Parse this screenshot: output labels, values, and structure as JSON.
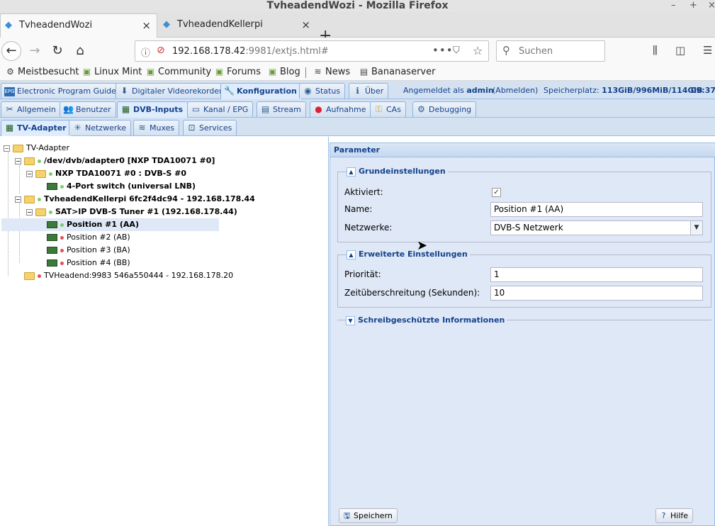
{
  "window": {
    "title": "TvheadendWozi - Mozilla Firefox",
    "min": "–",
    "max": "+",
    "close": "×"
  },
  "browser_tabs": [
    {
      "label": "TvheadendWozi",
      "active": true
    },
    {
      "label": "TvheadendKellerpi",
      "active": false
    }
  ],
  "tab_close": "×",
  "new_tab": "+",
  "nav": {
    "back": "←",
    "forward": "→",
    "reload": "↻",
    "home": "⌂",
    "url_host": "192.168.178.42",
    "url_rest": ":9981/extjs.html#",
    "url_dots": "•••",
    "search_placeholder": "Suchen",
    "library": "⫼",
    "sidebar": "◫",
    "menu": "☰"
  },
  "bookmarks": [
    {
      "label": "Meistbesucht",
      "icon": "gear-icon"
    },
    {
      "label": "Linux Mint",
      "icon": "mint-icon"
    },
    {
      "label": "Community",
      "icon": "mint-icon"
    },
    {
      "label": "Forums",
      "icon": "mint-icon"
    },
    {
      "label": "Blog",
      "icon": "mint-icon"
    },
    {
      "label": "News",
      "icon": "rss-icon"
    },
    {
      "label": "Bananaserver",
      "icon": "page-icon"
    }
  ],
  "main_tabs": [
    {
      "label": "Electronic Program Guide",
      "icon": "EPG"
    },
    {
      "label": "Digitaler Videorekorder",
      "icon": "⬇"
    },
    {
      "label": "Konfiguration",
      "icon": "🔧",
      "active": true
    },
    {
      "label": "Status",
      "icon": "👁"
    },
    {
      "label": "Über",
      "icon": "ℹ"
    }
  ],
  "status": {
    "logged_in_prefix": "Angemeldet als",
    "user": "admin",
    "logout": "(Abmelden)",
    "storage_prefix": "Speicherplatz:",
    "storage": "113GiB/996MiB/114GiB",
    "time": "09:37:3"
  },
  "config_tabs": [
    {
      "label": "Allgemein",
      "icon": "✂"
    },
    {
      "label": "Benutzer",
      "icon": "👥"
    },
    {
      "label": "DVB-Inputs",
      "icon": "▦",
      "active": true
    },
    {
      "label": "Kanal / EPG",
      "icon": "📺"
    },
    {
      "label": "Stream",
      "icon": "▤"
    },
    {
      "label": "Aufnahme",
      "icon": "●"
    },
    {
      "label": "CAs",
      "icon": "🔑"
    },
    {
      "label": "Debugging",
      "icon": "⚙"
    }
  ],
  "dvb_tabs": [
    {
      "label": "TV-Adapter",
      "icon": "▦",
      "active": true
    },
    {
      "label": "Netzwerke",
      "icon": "✳"
    },
    {
      "label": "Muxes",
      "icon": "≋"
    },
    {
      "label": "Services",
      "icon": "⊡"
    }
  ],
  "tree": [
    {
      "label": "TV-Adapter",
      "bold": false
    },
    {
      "label": "/dev/dvb/adapter0 [NXP TDA10071 #0]",
      "bold": true
    },
    {
      "label": "NXP TDA10071 #0 : DVB-S #0",
      "bold": true
    },
    {
      "label": "4-Port switch (universal LNB)",
      "bold": true
    },
    {
      "label": "TvheadendKellerpi 6fc2f4dc94 - 192.168.178.44",
      "bold": true
    },
    {
      "label": "SAT>IP DVB-S Tuner #1 (192.168.178.44)",
      "bold": true
    },
    {
      "label": "Position #1 (AA)",
      "bold": true,
      "selected": true
    },
    {
      "label": "Position #2 (AB)",
      "bold": false
    },
    {
      "label": "Position #3 (BA)",
      "bold": false
    },
    {
      "label": "Position #4 (BB)",
      "bold": false
    },
    {
      "label": "TVHeadend:9983 546a550444 - 192.168.178.20",
      "bold": false
    }
  ],
  "tree_toggle": "−",
  "params": {
    "header": "Parameter",
    "basic": {
      "title": "Grundeinstellungen",
      "enabled_label": "Aktiviert:",
      "enabled": true,
      "name_label": "Name:",
      "name_value": "Position #1 (AA)",
      "networks_label": "Netzwerke:",
      "networks_value": "DVB-S Netzwerk"
    },
    "advanced": {
      "title": "Erweiterte Einstellungen",
      "priority_label": "Priorität:",
      "priority_value": "1",
      "timeout_label": "Zeitüberschreitung (Sekunden):",
      "timeout_value": "10"
    },
    "readonly": {
      "title": "Schreibgeschützte Informationen"
    },
    "save": "Speichern",
    "help": "Hilfe"
  },
  "colors": {
    "ext_blue": "#15428b",
    "panel_bg": "#dfe8f6",
    "border": "#99bbe8"
  }
}
